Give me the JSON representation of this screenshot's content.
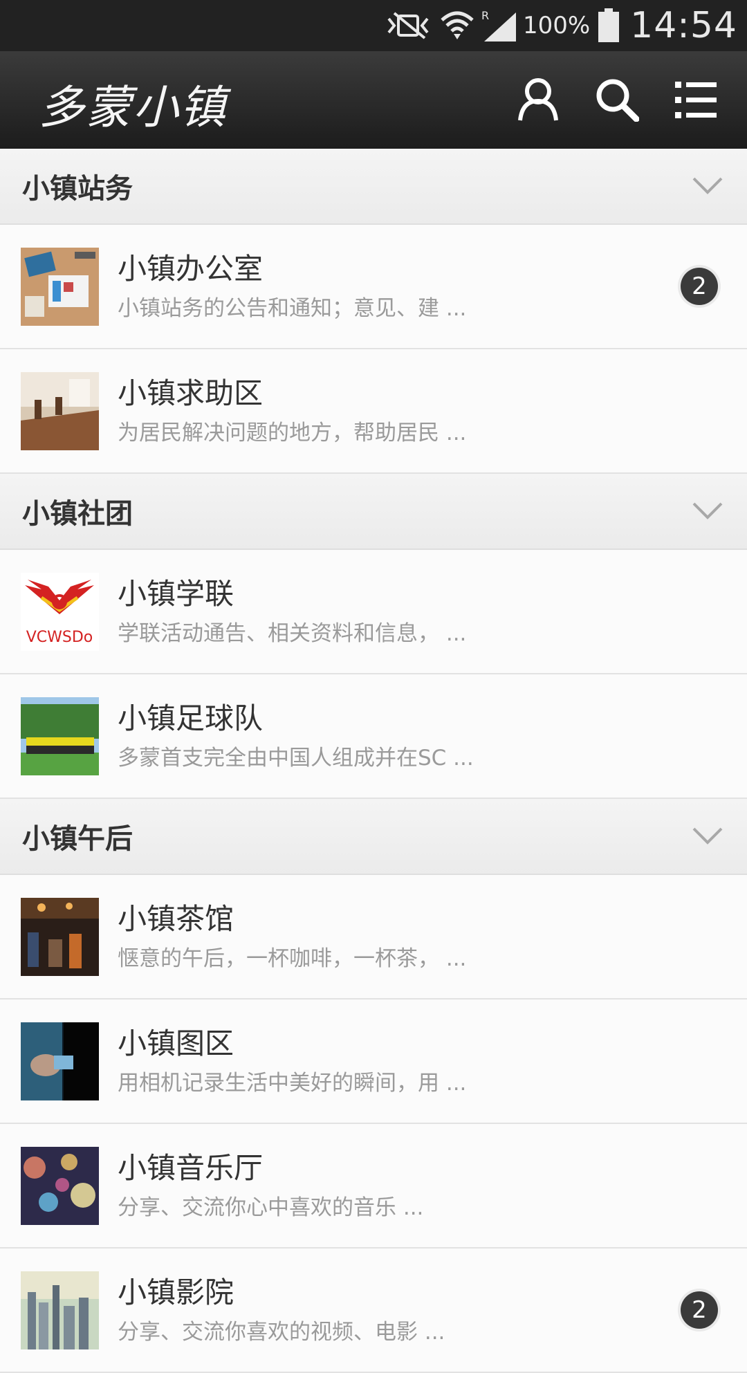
{
  "status_bar": {
    "battery_percent": "100%",
    "time": "14:54",
    "icons": [
      "vibrate-icon",
      "wifi-icon",
      "signal-icon",
      "battery-icon"
    ]
  },
  "header": {
    "logo_text": "多蒙小镇",
    "icons": [
      "user-icon",
      "search-icon",
      "menu-icon"
    ]
  },
  "sections": [
    {
      "title": "小镇站务",
      "items": [
        {
          "title": "小镇办公室",
          "desc": "小镇站务的公告和通知；意见、建 ...",
          "badge": "2",
          "thumb": "office-desk"
        },
        {
          "title": "小镇求助区",
          "desc": "为居民解决问题的地方，帮助居民 ...",
          "thumb": "cafe-table"
        }
      ]
    },
    {
      "title": "小镇社团",
      "items": [
        {
          "title": "小镇学联",
          "desc": "学联活动通告、相关资料和信息， ...",
          "thumb": "vcwsdo-logo",
          "thumb_text": "VCWSDo"
        },
        {
          "title": "小镇足球队",
          "desc": "多蒙首支完全由中国人组成并在SC ...",
          "thumb": "soccer-team"
        }
      ]
    },
    {
      "title": "小镇午后",
      "items": [
        {
          "title": "小镇茶馆",
          "desc": "惬意的午后，一杯咖啡，一杯茶， ...",
          "thumb": "teahouse"
        },
        {
          "title": "小镇图区",
          "desc": "用相机记录生活中美好的瞬间，用 ...",
          "thumb": "camera-hand"
        },
        {
          "title": "小镇音乐厅",
          "desc": "分享、交流你心中喜欢的音乐 ...",
          "thumb": "bokeh-lights"
        },
        {
          "title": "小镇影院",
          "desc": "分享、交流你喜欢的视频、电影 ...",
          "badge": "2",
          "thumb": "city-skyline"
        }
      ]
    }
  ],
  "colors": {
    "status_bar_bg": "#222222",
    "header_bg": "#2a2a2a",
    "badge_bg": "#3a3a3a"
  }
}
